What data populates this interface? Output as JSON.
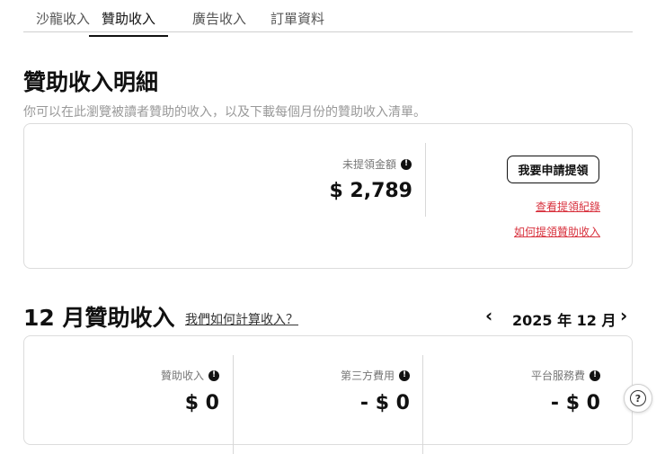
{
  "tabs": [
    {
      "label": "沙龍收入"
    },
    {
      "label": "贊助收入"
    },
    {
      "label": "廣告收入"
    },
    {
      "label": "訂單資料"
    }
  ],
  "header": {
    "title": "贊助收入明細",
    "subtitle": "你可以在此瀏覽被讀者贊助的收入，以及下載每個月份的贊助收入清單。"
  },
  "summary": {
    "unwithdrawn_label": "未提領金額",
    "unwithdrawn_value": "$ 2,789",
    "withdraw_button": "我要申請提領",
    "history_link": "查看提領紀錄",
    "howto_link": "如何提領贊助收入"
  },
  "monthly": {
    "title": "12 月贊助收入",
    "how_link": "我們如何計算收入？",
    "month_label": "2025 年 12 月",
    "stats": [
      {
        "label": "贊助收入",
        "value": "$ 0"
      },
      {
        "label": "第三方費用",
        "value": "- $ 0"
      },
      {
        "label": "平台服務費",
        "value": "- $ 0"
      }
    ]
  },
  "icons": {
    "info": "info-icon",
    "prev": "chevron-left-icon",
    "next": "chevron-right-icon",
    "help": "help-icon"
  }
}
